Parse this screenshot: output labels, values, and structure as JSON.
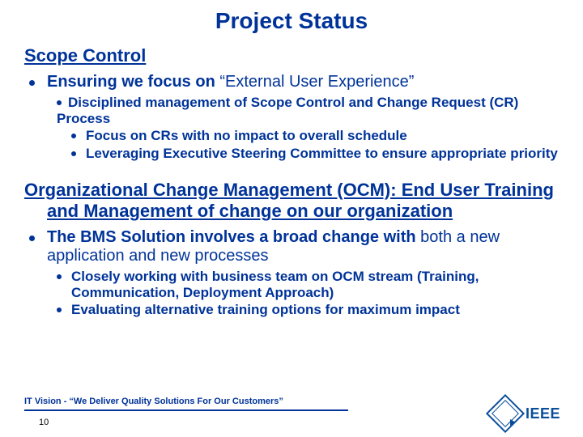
{
  "title": "Project Status",
  "sections": [
    {
      "heading": "Scope Control",
      "bullets": [
        {
          "strong": "Ensuring we focus on ",
          "soft": "“External User Experience”",
          "children": [
            {
              "text": "Disciplined management of Scope Control and Change Request (CR) Process",
              "children": [
                {
                  "text": "Focus on CRs with no impact to overall schedule"
                },
                {
                  "text": "Leveraging Executive Steering Committee to ensure appropriate priority"
                }
              ]
            }
          ]
        }
      ]
    },
    {
      "heading": "Organizational Change Management (OCM): End User Training and Management of change on our organization",
      "bullets": [
        {
          "strong": "The BMS Solution involves a broad change with ",
          "soft": "both a new application and new processes",
          "children": [
            {
              "text": "Closely working with business team on OCM stream (Training, Communication, Deployment Approach)"
            },
            {
              "text": "Evaluating alternative training options for maximum impact"
            }
          ]
        }
      ]
    }
  ],
  "footer": {
    "tagline": "IT Vision - “We Deliver Quality Solutions For Our Customers”",
    "page": "10"
  },
  "logo": {
    "text": "IEEE"
  }
}
